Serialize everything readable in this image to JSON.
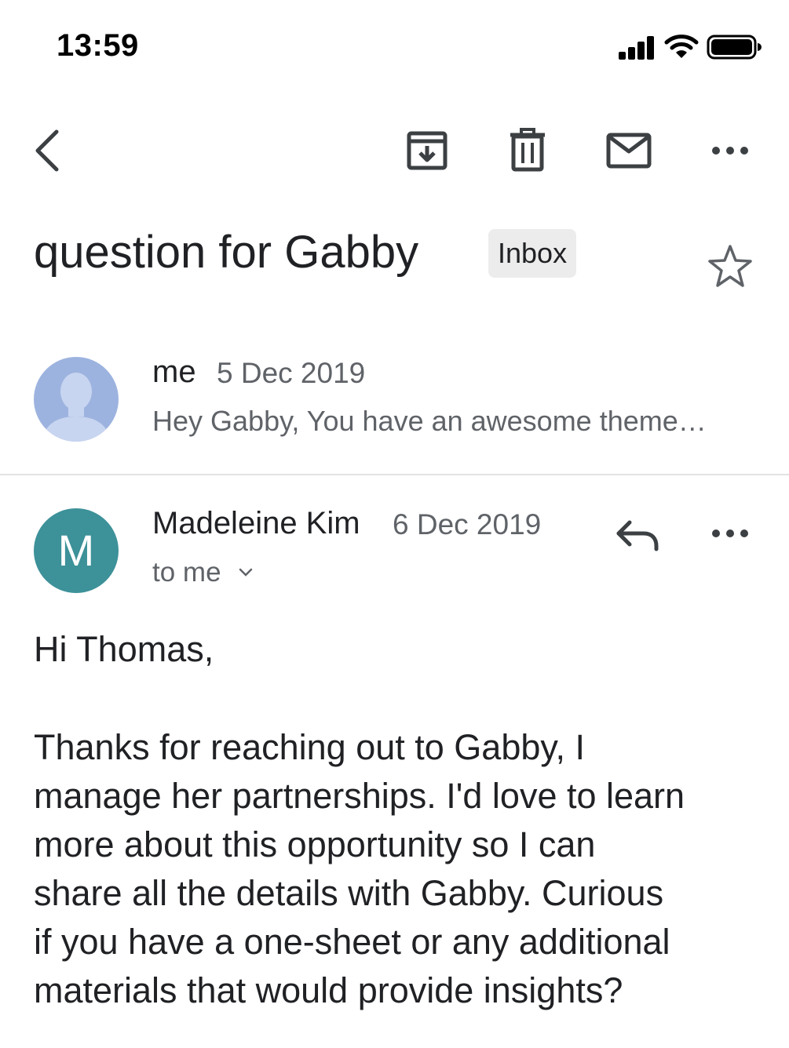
{
  "status_bar": {
    "time": "13:59",
    "icons": [
      "signal-icon",
      "wifi-icon",
      "battery-icon"
    ]
  },
  "toolbar": {
    "icons": [
      "back-chevron-icon",
      "archive-icon",
      "trash-icon",
      "mail-icon",
      "more-horizontal-icon"
    ]
  },
  "thread": {
    "subject": "question for Gabby",
    "label": "Inbox",
    "starred": false
  },
  "messages": [
    {
      "sender": "me",
      "date": "5 Dec 2019",
      "snippet": "Hey Gabby, You have an awesome theme…",
      "avatar": "person-placeholder",
      "avatar_color": "#9db3df"
    },
    {
      "sender": "Madeleine Kim",
      "date": "6 Dec 2019",
      "avatar_initial": "M",
      "avatar_color": "#3d9199",
      "recipients": "to me",
      "greeting": "Hi Thomas,",
      "body_lines": [
        "Thanks for reaching out to Gabby, I",
        "manage her partnerships. I'd love to learn",
        "more about this opportunity so I can",
        "share all the details with Gabby. Curious",
        "if you have a one-sheet or any additional",
        "materials that would provide insights?"
      ]
    }
  ],
  "colors": {
    "text_primary": "#202124",
    "text_secondary": "#5f6368",
    "badge_bg": "#ececec",
    "divider": "#e3e3e3"
  }
}
